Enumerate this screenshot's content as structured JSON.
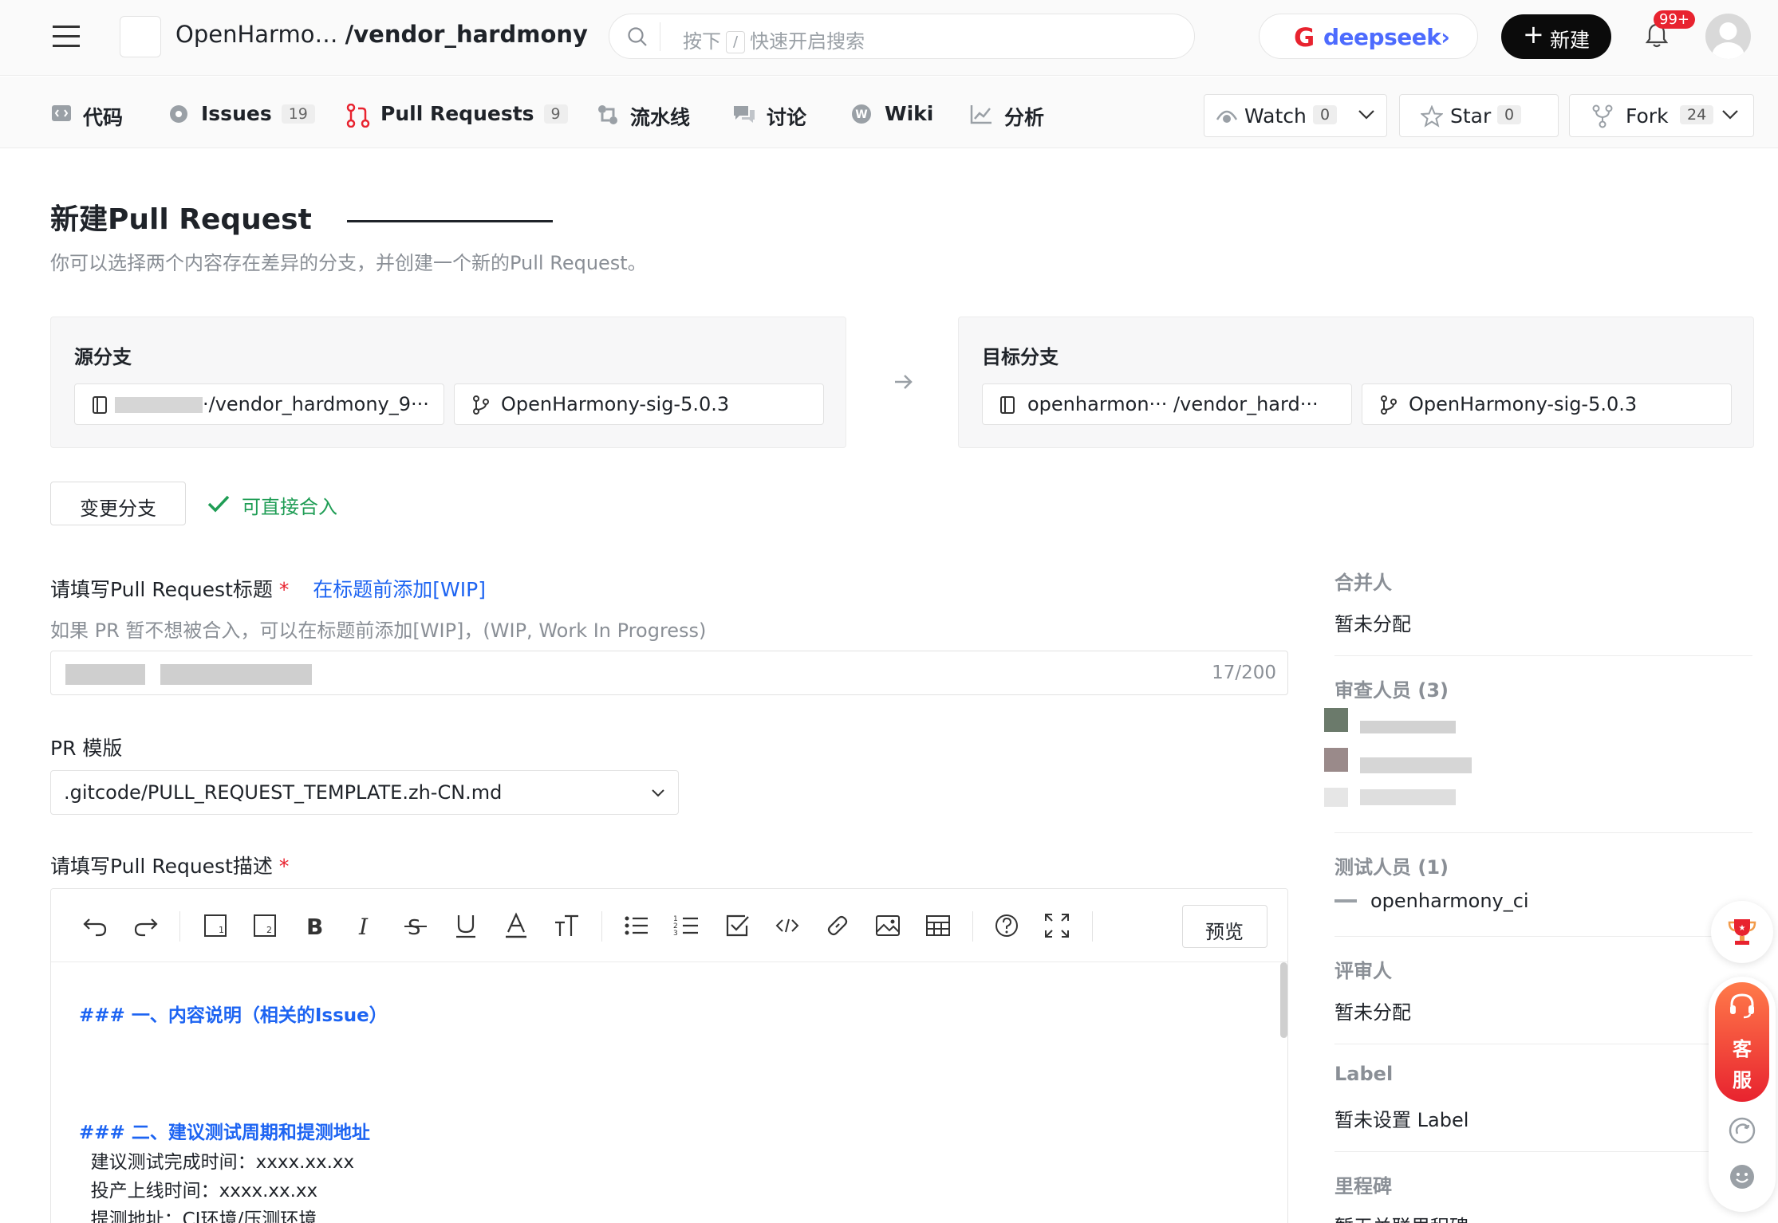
{
  "header": {
    "repo_owner": "OpenHarmo…",
    "repo_name": "/vendor_hardmony",
    "search_placeholder_pre": "按下",
    "search_key": "/",
    "search_placeholder_post": "快速开启搜索",
    "deepseek_label": "deepseek",
    "deepseek_arrow": "›",
    "new_button": "新建",
    "notification_badge": "99+"
  },
  "tabs": [
    {
      "label": "代码",
      "icon": "code-icon"
    },
    {
      "label": "Issues",
      "count": "19",
      "icon": "issue-icon"
    },
    {
      "label": "Pull Requests",
      "count": "9",
      "icon": "pull-request-icon",
      "active": true
    },
    {
      "label": "流水线",
      "icon": "pipeline-icon"
    },
    {
      "label": "讨论",
      "icon": "discussion-icon"
    },
    {
      "label": "Wiki",
      "icon": "wiki-icon"
    },
    {
      "label": "分析",
      "icon": "analytics-icon"
    }
  ],
  "repo_actions": {
    "watch_label": "Watch",
    "watch_count": "0",
    "star_label": "Star",
    "star_count": "0",
    "fork_label": "Fork",
    "fork_count": "24"
  },
  "page": {
    "title": "新建Pull Request",
    "subtitle": "你可以选择两个内容存在差异的分支，并创建一个新的Pull Request。"
  },
  "source": {
    "label": "源分支",
    "repo": "·/vendor_hardmony_9···",
    "branch": "OpenHarmony-sig-5.0.3"
  },
  "target": {
    "label": "目标分支",
    "repo": "openharmon··· /vendor_hard···",
    "branch": "OpenHarmony-sig-5.0.3"
  },
  "change_branch_button": "变更分支",
  "merge_status": "可直接合入",
  "form": {
    "title_label": "请填写Pull Request标题",
    "required_mark": "*",
    "wip_link": "在标题前添加[WIP]",
    "title_hint": "如果 PR 暂不想被合入，可以在标题前添加[WIP]，(WIP, Work In Progress)",
    "title_counter": "17/200",
    "template_label": "PR 模版",
    "template_value": ".gitcode/PULL_REQUEST_TEMPLATE.zh-CN.md",
    "desc_label": "请填写Pull Request描述"
  },
  "editor": {
    "preview_button": "预览",
    "lines": [
      "### 一、内容说明（相关的Issue）",
      "### 二、建议测试周期和提测地址",
      "  建议测试完成时间：xxxx.xx.xx",
      "  投产上线时间：xxxx.xx.xx",
      "  提测地址：CI环境/压测环境"
    ]
  },
  "sidebar": {
    "merger_title": "合并人",
    "merger_value": "暂未分配",
    "reviewers_title": "审查人员 (3)",
    "testers_title": "测试人员 (1)",
    "tester_name": "openharmony_ci",
    "assessor_title": "评审人",
    "assessor_value": "暂未分配",
    "label_title": "Label",
    "label_value": "暂未设置 Label",
    "milestone_title": "里程碑",
    "milestone_value": "暂无关联里程碑"
  },
  "float": {
    "service_label_1": "客",
    "service_label_2": "服"
  }
}
